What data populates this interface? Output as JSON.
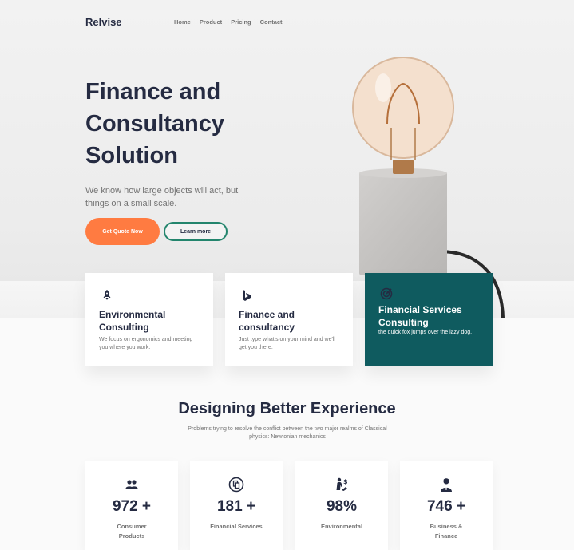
{
  "header": {
    "brand": "Relvise",
    "nav": [
      "Home",
      "Product",
      "Pricing",
      "Contact"
    ]
  },
  "hero": {
    "title": "Finance and Consultancy Solution",
    "subtitle": "We know how large objects will act, but things on a small scale.",
    "primary_button": "Get Quote Now",
    "secondary_button": "Learn more"
  },
  "services": [
    {
      "icon": "rocket-icon",
      "title": "Environmental Consulting",
      "text": "We focus on ergonomics and meeting you where you work."
    },
    {
      "icon": "bing-logo-icon",
      "title": "Finance and consultancy",
      "text": "Just type what's on your mind and we'll get you there."
    },
    {
      "icon": "target-icon",
      "title": "Financial Services Consulting",
      "text": "the quick fox jumps over the lazy dog."
    }
  ],
  "section": {
    "title": "Designing Better Experience",
    "subtitle": "Problems trying to resolve the conflict between the two major realms of Classical physics: Newtonian mechanics"
  },
  "stats": [
    {
      "icon": "users-icon",
      "value": "972 +",
      "label": "Consumer Products"
    },
    {
      "icon": "copy-icon",
      "value": "181 +",
      "label": "Financial Services"
    },
    {
      "icon": "hand-money-icon",
      "value": "98%",
      "label": "Environmental"
    },
    {
      "icon": "businessman-icon",
      "value": "746 +",
      "label": "Business & Finance"
    }
  ],
  "colors": {
    "accent_orange": "#ff7b41",
    "accent_teal": "#0f5b5f",
    "button_outline": "#23856d",
    "heading": "#252b42",
    "muted_text": "#737373"
  }
}
